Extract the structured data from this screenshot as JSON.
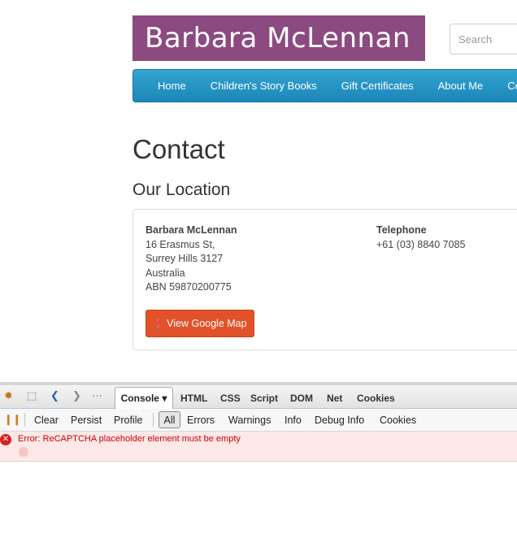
{
  "site": {
    "logo": "Barbara McLennan",
    "search_placeholder": "Search",
    "nav": [
      "Home",
      "Children's Story Books",
      "Gift Certificates",
      "About Me",
      "Contact"
    ]
  },
  "page": {
    "title": "Contact",
    "subtitle": "Our Location"
  },
  "location": {
    "name": "Barbara McLennan",
    "street": "16 Erasmus St,",
    "suburb": "Surrey Hills 3127",
    "country": "Australia",
    "abn": "ABN 59870200775",
    "telephone_label": "Telephone",
    "telephone": "+61 (03) 8840 7085",
    "map_button": "View Google Map"
  },
  "firebug": {
    "console_tab": "Console ▾",
    "tabs": [
      "HTML",
      "CSS",
      "Script",
      "DOM",
      "Net",
      "Cookies"
    ],
    "toolbar": [
      "Clear",
      "Persist",
      "Profile"
    ],
    "filter_selected": "All",
    "filters": [
      "Errors",
      "Warnings",
      "Info",
      "Debug Info",
      "Cookies"
    ],
    "error_message": "Error: ReCAPTCHA placeholder element must be empty"
  },
  "colors": {
    "logo_bg": "#8b4a80",
    "nav_bg": "#1b87b8",
    "button_bg": "#e2522a",
    "error_bg": "#fde8e8"
  }
}
